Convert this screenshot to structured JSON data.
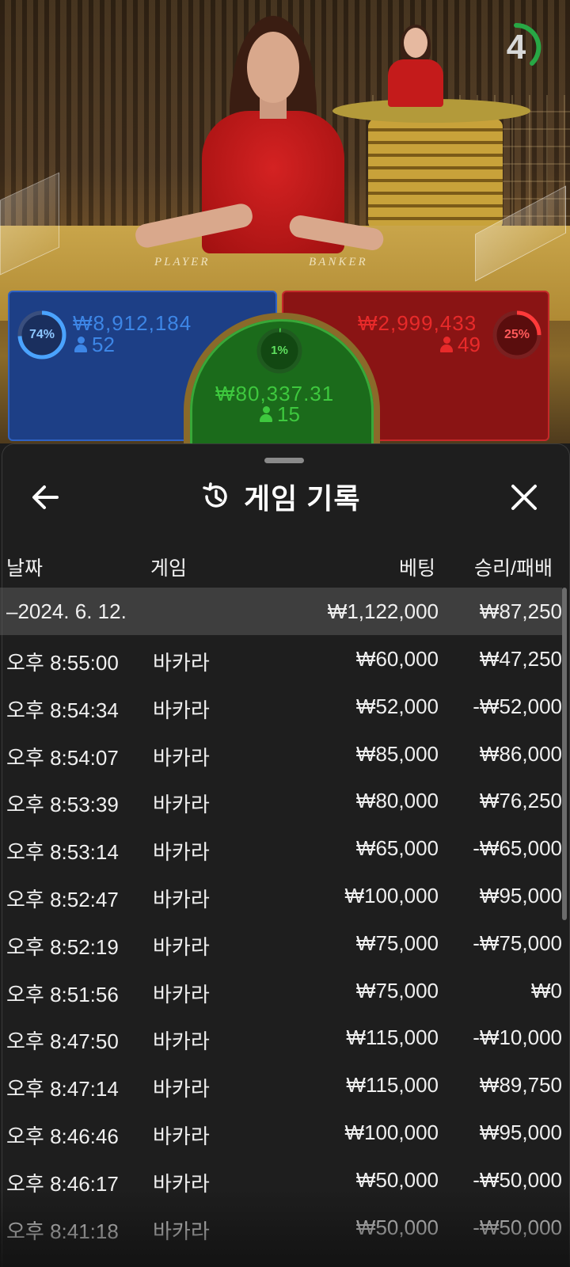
{
  "stream": {
    "countdown": "4",
    "table_labels": {
      "player": "PLAYER",
      "banker": "BANKER"
    }
  },
  "bets": {
    "player": {
      "percent_text": "74%",
      "percent": 74,
      "amount": "₩8,912,184",
      "count": "52",
      "color": "#2f62c4"
    },
    "tie": {
      "percent_text": "1%",
      "percent": 1,
      "amount": "₩80,337.31",
      "count": "15",
      "color": "#38c838"
    },
    "banker": {
      "percent_text": "25%",
      "percent": 25,
      "amount": "₩2,999,433",
      "count": "49",
      "color": "#e02424"
    }
  },
  "history": {
    "title": "게임 기록",
    "columns": {
      "date": "날짜",
      "game": "게임",
      "bet": "베팅",
      "result": "승리/패배"
    },
    "summary": {
      "date": "–2024. 6. 12.",
      "bet": "₩1,122,000",
      "result": "₩87,250"
    },
    "rows": [
      {
        "time": "오후 8:55:00",
        "game": "바카라",
        "bet": "₩60,000",
        "result": "₩47,250"
      },
      {
        "time": "오후 8:54:34",
        "game": "바카라",
        "bet": "₩52,000",
        "result": "-₩52,000"
      },
      {
        "time": "오후 8:54:07",
        "game": "바카라",
        "bet": "₩85,000",
        "result": "₩86,000"
      },
      {
        "time": "오후 8:53:39",
        "game": "바카라",
        "bet": "₩80,000",
        "result": "₩76,250"
      },
      {
        "time": "오후 8:53:14",
        "game": "바카라",
        "bet": "₩65,000",
        "result": "-₩65,000"
      },
      {
        "time": "오후 8:52:47",
        "game": "바카라",
        "bet": "₩100,000",
        "result": "₩95,000"
      },
      {
        "time": "오후 8:52:19",
        "game": "바카라",
        "bet": "₩75,000",
        "result": "-₩75,000"
      },
      {
        "time": "오후 8:51:56",
        "game": "바카라",
        "bet": "₩75,000",
        "result": "₩0"
      },
      {
        "time": "오후 8:47:50",
        "game": "바카라",
        "bet": "₩115,000",
        "result": "-₩10,000"
      },
      {
        "time": "오후 8:47:14",
        "game": "바카라",
        "bet": "₩115,000",
        "result": "₩89,750"
      },
      {
        "time": "오후 8:46:46",
        "game": "바카라",
        "bet": "₩100,000",
        "result": "₩95,000"
      },
      {
        "time": "오후 8:46:17",
        "game": "바카라",
        "bet": "₩50,000",
        "result": "-₩50,000"
      },
      {
        "time": "오후 8:41:18",
        "game": "바카라",
        "bet": "₩50,000",
        "result": "-₩50,000"
      }
    ]
  },
  "icons": {
    "back": "arrow-left-icon",
    "history": "history-icon",
    "close": "close-icon",
    "player": "person-icon"
  }
}
